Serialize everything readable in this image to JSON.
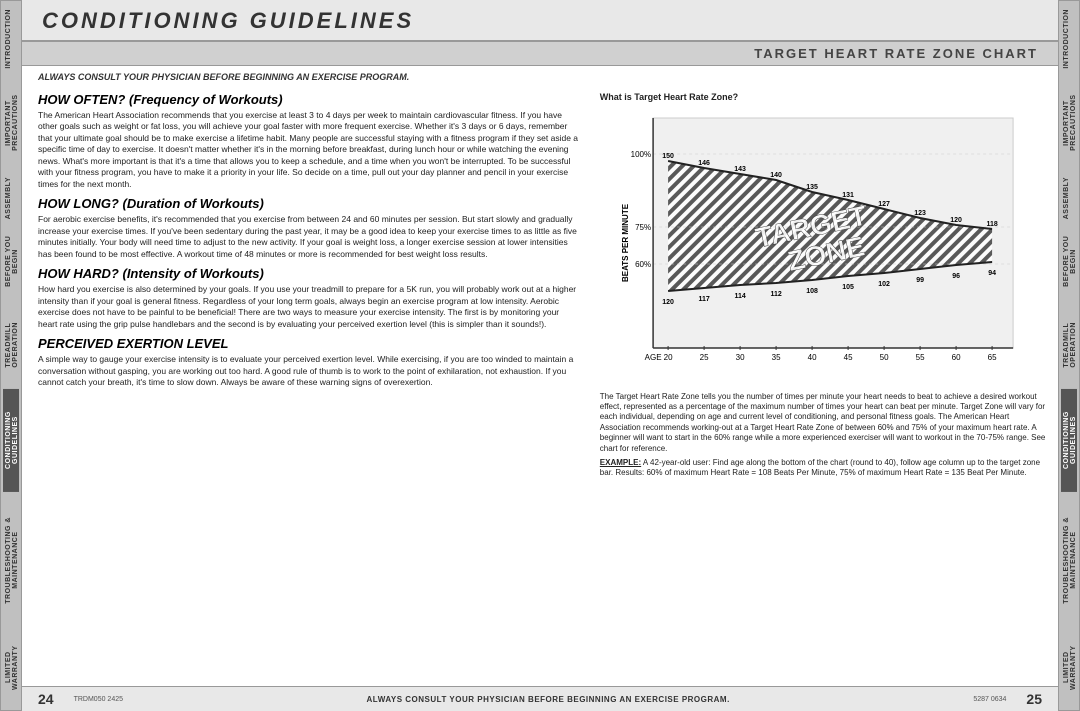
{
  "left_side_tabs": [
    {
      "label": "INTRODUCTION",
      "active": false
    },
    {
      "label": "IMPORTANT PRECAUTIONS",
      "active": false
    },
    {
      "label": "ASSEMBLY",
      "active": false
    },
    {
      "label": "BEFORE YOU BEGIN",
      "active": false
    },
    {
      "label": "TREADMILL OPERATION",
      "active": false
    },
    {
      "label": "CONDITIONING GUIDELINES",
      "active": true
    },
    {
      "label": "TROUBLESHOOTING & MAINTENANCE",
      "active": false
    },
    {
      "label": "LIMITED WARRANTY",
      "active": false
    }
  ],
  "right_side_tabs": [
    {
      "label": "INTRODUCTION",
      "active": false
    },
    {
      "label": "IMPORTANT PRECAUTIONS",
      "active": false
    },
    {
      "label": "ASSEMBLY",
      "active": false
    },
    {
      "label": "BEFORE YOU BEGIN",
      "active": false
    },
    {
      "label": "TREADMILL OPERATION",
      "active": false
    },
    {
      "label": "CONDITIONING GUIDELINES",
      "active": true
    },
    {
      "label": "TROUBLESHOOTING & MAINTENANCE",
      "active": false
    },
    {
      "label": "LIMITED WARRANTY",
      "active": false
    }
  ],
  "page_title": "CONDITIONING GUIDELINES",
  "sub_header": "TARGET HEART RATE ZONE CHART",
  "physician_notice": "ALWAYS CONSULT YOUR PHYSICIAN BEFORE BEGINNING AN EXERCISE PROGRAM.",
  "sections": {
    "how_often": {
      "title": "HOW OFTEN? (Frequency of Workouts)",
      "text": "The American Heart Association recommends that you exercise at least 3 to 4 days per week to maintain cardiovascular fitness. If you have other goals such as weight or fat loss, you will achieve your goal faster with more frequent exercise. Whether it's 3 days or 6 days, remember that your ultimate goal should be to make exercise a lifetime habit. Many people are successful staying with a fitness program if they set aside a specific time of day to exercise. It doesn't matter whether it's in the morning before breakfast, during lunch hour or while watching the evening news. What's more important is that it's a time that allows you to keep a schedule, and a time when you won't be interrupted. To be successful with your fitness program, you have to make it a priority in your life. So decide on a time, pull out your day planner and pencil in your exercise times for the next month."
    },
    "how_long": {
      "title": "HOW LONG? (Duration of Workouts)",
      "text": "For aerobic exercise benefits, it's recommended that you exercise from between 24 and 60 minutes per session. But start slowly and gradually increase your exercise times. If you've been sedentary during the past year, it may be a good idea to keep your exercise times to as little as five minutes initially. Your body will need time to adjust to the new activity. If your goal is weight loss, a longer exercise session at lower intensities has been found to be most effective. A workout time of 48 minutes or more is recommended for best weight loss results."
    },
    "how_hard": {
      "title": "HOW HARD? (Intensity of Workouts)",
      "text": "How hard you exercise is also determined by your goals. If you use your treadmill to prepare for a 5K run, you will probably work out at a higher intensity than if your goal is general fitness. Regardless of your long term goals, always begin an exercise program at low intensity. Aerobic exercise does not have to be painful to be beneficial! There are two ways to measure your exercise intensity. The first is by monitoring your heart rate using the grip pulse handlebars and the second is by evaluating your perceived exertion level (this is simpler than it sounds!)."
    },
    "perceived_exertion": {
      "title": "PERCEIVED EXERTION LEVEL",
      "text": "A simple way to gauge your exercise intensity is to evaluate your perceived exertion level. While exercising, if you are too winded to maintain a conversation without gasping, you are working out too hard. A good rule of thumb is to work to the point of exhilaration, not exhaustion. If you cannot catch your breath, it's time to slow down. Always be aware of these warning signs of overexertion."
    }
  },
  "right_column": {
    "what_is_title": "What is Target Heart Rate Zone?",
    "what_is_text": "The Target Heart Rate Zone tells you the number of times per minute your heart needs to beat to achieve a desired workout effect, represented as a percentage of the maximum number of times your heart can beat per minute. Target Zone will vary for each individual, depending on age and current level of conditioning, and personal fitness goals. The American Heart Association recommends working-out at a Target Heart Rate Zone of between 60% and 75% of your maximum heart rate. A beginner will want to start in the 60% range while a more experienced exerciser will want to workout in the 70-75% range. See chart for reference.",
    "example_label": "EXAMPLE:",
    "example_text": "A 42-year-old user: Find age along the bottom of the chart (round to 40), follow age column up to the target zone bar. Results: 60% of maximum Heart Rate = 108 Beats Per Minute, 75% of maximum Heart Rate = 135 Beat Per Minute."
  },
  "footer": {
    "page_left": "24",
    "page_right": "25",
    "notice": "ALWAYS CONSULT YOUR PHYSICIAN BEFORE BEGINNING AN EXERCISE PROGRAM.",
    "code_left": "TRDM050 2425",
    "code_right": "5287 0634"
  },
  "chart": {
    "ages": [
      "20",
      "25",
      "30",
      "35",
      "40",
      "45",
      "50",
      "55",
      "60",
      "65"
    ],
    "label": "TARGET ZONE",
    "y_label": "BEATS PER MINUTE",
    "percentages": [
      "100%",
      "75%",
      "60%"
    ],
    "data_75": [
      150,
      146,
      143,
      140,
      135,
      131,
      127,
      123,
      120,
      118
    ],
    "data_60": [
      120,
      117,
      114,
      112,
      108,
      105,
      102,
      99,
      96,
      94
    ]
  }
}
